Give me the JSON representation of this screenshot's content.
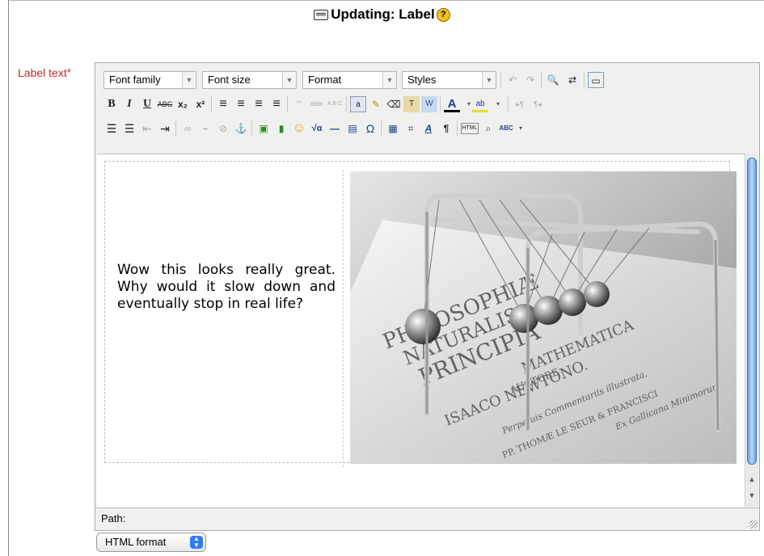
{
  "page": {
    "title": "Updating: Label"
  },
  "form": {
    "label": "Label text",
    "required_mark": "*"
  },
  "toolbar": {
    "selects": {
      "font_family": "Font family",
      "font_size": "Font size",
      "format": "Format",
      "styles": "Styles"
    },
    "glyphs": {
      "undo": "↶",
      "redo": "↷",
      "find": "🔍",
      "replace": "⇄",
      "fullscreen": "▭",
      "bold": "B",
      "italic": "I",
      "underline": "U",
      "strike": "ABC",
      "subscript": "x₂",
      "superscript": "x²",
      "align_left": "≡",
      "align_center": "≡",
      "align_right": "≡",
      "align_justify": "≡",
      "cite": "“”",
      "abbr": "abbr",
      "acronym": "A.B.C",
      "paste_text": "a",
      "clean": "✎",
      "eraser": "⌫",
      "paste_plain": "T",
      "paste_word": "W",
      "forecolor": "A",
      "backcolor": "ab",
      "ltr": "▸¶",
      "rtl": "¶◂",
      "bullist": "☰",
      "numlist": "☰",
      "outdent": "⇤",
      "indent": "⇥",
      "link": "∞",
      "unlink": "⌁",
      "nolink": "⊘",
      "anchor": "⚓",
      "image": "▣",
      "media": "▮",
      "emotion": "☺",
      "equation": "√α",
      "hr": "—",
      "moodle_media": "▤",
      "charmap": "Ω",
      "edit_table": "▦",
      "cells": "⌗",
      "spell": "A",
      "show_blocks": "¶",
      "html": "HTML",
      "search_replace": "⌕",
      "spellcheck": "ABC"
    }
  },
  "editor": {
    "text": "Wow this looks really great. Why would it slow down and eventually stop in real life?",
    "image_text": [
      "PHILOSOPHIÆ",
      "NATURALIS",
      "PRINCIPIA",
      "MATHEMATICA",
      "AUCTORE",
      "ISAACO NEWTONO.",
      "Perpetuis Commentariis illustrata,",
      "PP. THOMÆ LE SEUR & FRANCISCI",
      "Ex Gallicana Minimorum"
    ],
    "path_label": "Path:"
  },
  "format_select": {
    "value": "HTML format"
  },
  "colors": {
    "required": "#c8262c",
    "scroll_thumb": "#6aa0e6",
    "select_stepper": "#2f7bf5"
  }
}
